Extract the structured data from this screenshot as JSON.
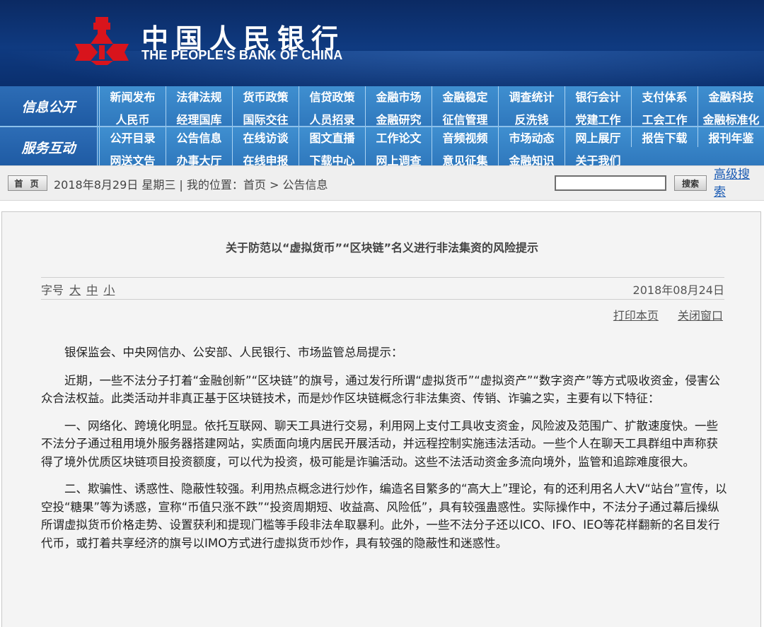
{
  "header": {
    "logo_cn": "中国人民银行",
    "logo_en": "THE PEOPLE'S BANK OF CHINA"
  },
  "nav": {
    "row1_label": "信息公开",
    "row1_items": [
      "新闻发布",
      "法律法规",
      "货币政策",
      "信贷政策",
      "金融市场",
      "金融稳定",
      "调查统计",
      "银行会计",
      "支付体系",
      "金融科技",
      "人民币",
      "经理国库",
      "国际交往",
      "人员招录",
      "金融研究",
      "征信管理",
      "反洗钱",
      "党建工作",
      "工会工作",
      "金融标准化"
    ],
    "row2_label": "服务互动",
    "row2_items": [
      "公开目录",
      "公告信息",
      "在线访谈",
      "图文直播",
      "工作论文",
      "音频视频",
      "市场动态",
      "网上展厅",
      "报告下载",
      "报刊年鉴",
      "网送文告",
      "办事大厅",
      "在线申报",
      "下载中心",
      "网上调查",
      "意见征集",
      "金融知识",
      "关于我们"
    ]
  },
  "location": {
    "home_button": "首 页",
    "text": "2018年8月29日 星期三 | 我的位置：首页 > 公告信息",
    "search_value": "",
    "search_button": "搜索",
    "advanced_search": "高级搜索"
  },
  "article": {
    "title": "关于防范以“虚拟货币”“区块链”名义进行非法集资的风险提示",
    "font_size_label": "字号",
    "font_sizes": [
      "大",
      "中",
      "小"
    ],
    "date": "2018年08月24日",
    "print": "打印本页",
    "close": "关闭窗口",
    "paragraphs": [
      "银保监会、中央网信办、公安部、人民银行、市场监管总局提示：",
      "近期，一些不法分子打着“金融创新”“区块链”的旗号，通过发行所谓“虚拟货币”“虚拟资产”“数字资产”等方式吸收资金，侵害公众合法权益。此类活动并非真正基于区块链技术，而是炒作区块链概念行非法集资、传销、诈骗之实，主要有以下特征：",
      "一、网络化、跨境化明显。依托互联网、聊天工具进行交易，利用网上支付工具收支资金，风险波及范围广、扩散速度快。一些不法分子通过租用境外服务器搭建网站，实质面向境内居民开展活动，并远程控制实施违法活动。一些个人在聊天工具群组中声称获得了境外优质区块链项目投资额度，可以代为投资，极可能是诈骗活动。这些不法活动资金多流向境外，监管和追踪难度很大。",
      "二、欺骗性、诱惑性、隐蔽性较强。利用热点概念进行炒作，编造名目繁多的“高大上”理论，有的还利用名人大V“站台”宣传，以空投“糖果”等为诱惑，宣称“币值只涨不跌”“投资周期短、收益高、风险低”，具有较强蛊惑性。实际操作中，不法分子通过幕后操纵所谓虚拟货币价格走势、设置获利和提现门槛等手段非法牟取暴利。此外，一些不法分子还以ICO、IFO、IEO等花样翻新的名目发行代币，或打着共享经济的旗号以IMO方式进行虚拟货币炒作，具有较强的隐蔽性和迷惑性。"
    ]
  },
  "colors": {
    "banner": "#0f3a80",
    "nav": "#3a88cb",
    "logo_red": "#d8141c",
    "link": "#1a5bb4"
  }
}
